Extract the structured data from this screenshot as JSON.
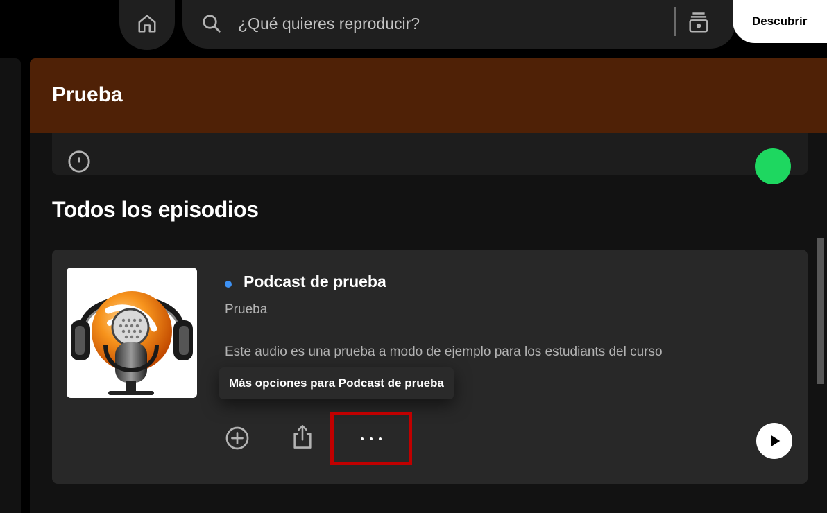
{
  "top_bar": {
    "home_icon": "home-icon",
    "search": {
      "icon": "search-icon",
      "placeholder": "¿Qué quieres reproducir?",
      "browse_icon": "browse-icon"
    },
    "discover_label": "Descubrir"
  },
  "header": {
    "title": "Prueba",
    "color": "#4f2106"
  },
  "section": {
    "title": "Todos los episodios"
  },
  "episode": {
    "title": "Podcast de prueba",
    "show": "Prueba",
    "description": "Este audio es una prueba a modo de ejemplo para los estudiants del curso",
    "new_indicator_color": "#3d91f4",
    "cover_icon": "podcast-microphone-headphones",
    "actions": {
      "add_icon": "add-circle-icon",
      "share_icon": "share-icon",
      "more_icon": "more-options-icon",
      "play_icon": "play-icon"
    },
    "tooltip": "Más opciones para Podcast de prueba",
    "highlight_color": "#c00000"
  },
  "colors": {
    "background": "#121212",
    "card": "#282828",
    "accent_green": "#1ed760"
  }
}
